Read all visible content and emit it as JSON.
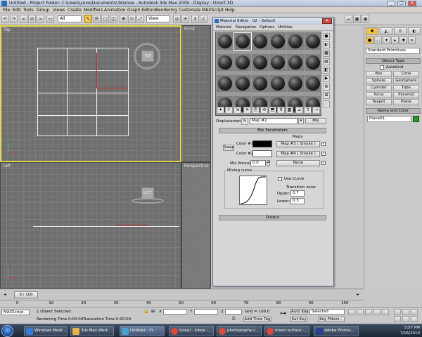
{
  "window": {
    "title": "Untitled   - Project Folder: C:\\Users\\Love\\Documents\\3dsmax    - Autodesk 3ds Max  2009    - Display : Direct 3D",
    "buttons": [
      "_",
      "□",
      "X"
    ]
  },
  "menu": [
    "File",
    "Edit",
    "Tools",
    "Group",
    "Views",
    "Create",
    "Modifiers",
    "Animation",
    "Graph Editors",
    "Rendering",
    "Customize",
    "MAXScript",
    "Help"
  ],
  "toolbar": {
    "selection_filter": "All",
    "ref_coord": "View",
    "snap_counter": "3"
  },
  "viewports": {
    "top": {
      "label": "Top",
      "cube_label": "TOP"
    },
    "front": {
      "label": "Front"
    },
    "left": {
      "label": "Left",
      "cube_label": "LEFT"
    },
    "perspective": {
      "label": "Perspective"
    }
  },
  "material_editor": {
    "title": "Material Editor - 02 - Default",
    "menu": [
      "Material",
      "Navigation",
      "Options",
      "Utilities"
    ],
    "slots_rows": 4,
    "slots_cols": 6,
    "displacement_label": "Displacement",
    "map_name": "Map #2",
    "mix_button": "Mix",
    "mix_params_title": "Mix Parameters",
    "maps_header": "Maps",
    "swap_label": "Swap",
    "color1_label": "Color #1",
    "color2_label": "Color #2",
    "color1_map": "Map #3  ( Smoke )",
    "color2_map": "Map #4  ( Smoke )",
    "mix_amount_label": "Mix Amount",
    "mix_amount_value": "0.0",
    "mix_amount_map": "None",
    "mixing_curve_label": "Mixing curve",
    "use_curve_label": "Use Curve",
    "transition_zone_label": "Transition zone:",
    "upper_label": "Upper:",
    "upper_value": "0.7",
    "lower_label": "Lower:",
    "lower_value": "0.3",
    "output_label": "Output",
    "color1": "#000000",
    "color2": "#ffffff"
  },
  "command_panel": {
    "category": "Standard Primitives",
    "object_type_title": "Object Type",
    "autogrid_label": "AutoGrid",
    "objects": [
      "Box",
      "Cone",
      "Sphere",
      "GeoSphere",
      "Cylinder",
      "Tube",
      "Torus",
      "Pyramid",
      "Teapot",
      "Plane"
    ],
    "name_color_title": "Name and Color",
    "object_name": "Plane01",
    "object_color": "#1fa01f"
  },
  "timeline": {
    "frame_readout": "0 / 100",
    "ticks": [
      "0",
      "10",
      "20",
      "30",
      "40",
      "50",
      "60",
      "70",
      "80",
      "90",
      "100"
    ]
  },
  "status": {
    "maxscript_label": "MAXScript.",
    "selection_text": "1 Object Selected",
    "rendering_time": "Rendering Time  0:00:00",
    "translation_time": "Translation Time  0:00:00",
    "x_label": "X",
    "y_label": "Y",
    "z_label": "Z",
    "grid": "Grid = 100.0",
    "add_time_tag": "Add Time Tag",
    "auto_key": "Auto Key",
    "set_key": "Set Key",
    "key_mode": "Selected",
    "key_filters": "Key Filters..."
  },
  "taskbar": {
    "tasks": [
      {
        "label": "Windows Medi...",
        "color": "#3a7bd5"
      },
      {
        "label": "3ds Max Work",
        "color": "#e6b34a"
      },
      {
        "label": "Untitled    - Pr...",
        "color": "#4aa0c8"
      },
      {
        "label": "Gmail - Inbox -...",
        "color": "#d94c3d"
      },
      {
        "label": "photography c...",
        "color": "#d94c3d"
      },
      {
        "label": "moon surface -...",
        "color": "#d94c3d"
      },
      {
        "label": "Adobe Photos...",
        "color": "#2a3f8f"
      }
    ],
    "time": "5:57 PM",
    "date": "7/16/2010"
  }
}
